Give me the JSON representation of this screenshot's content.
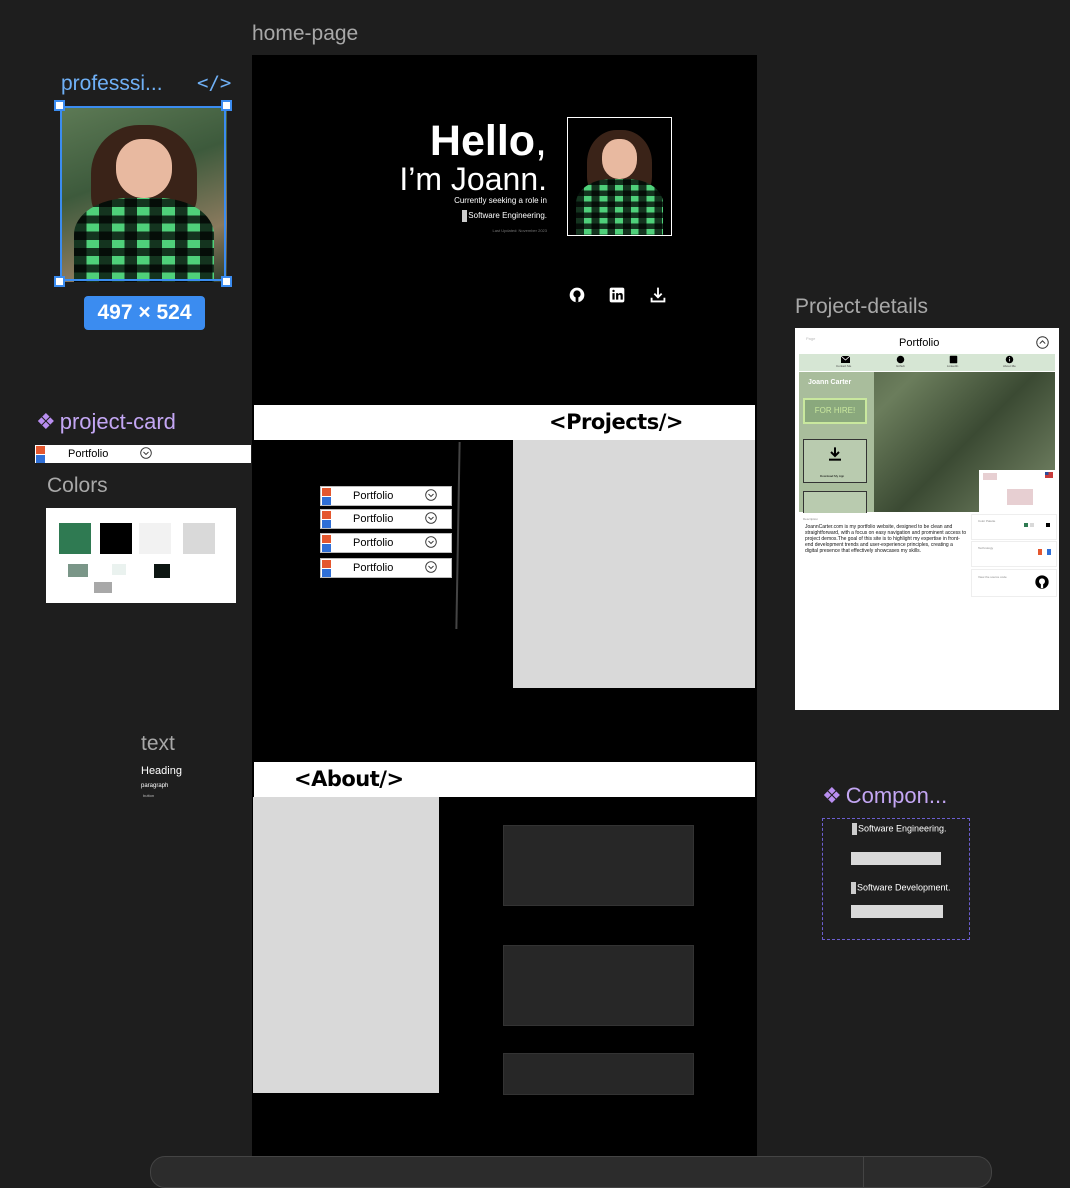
{
  "canvas": {
    "home_label": "home-page",
    "details_label": "Project-details",
    "card_label": "project-card",
    "colors_label": "Colors",
    "text_label": "text",
    "component_label": "Compon..."
  },
  "selection": {
    "label": "professsi...",
    "size": "497 × 524"
  },
  "hero": {
    "hello": "Hello",
    "comma": ",",
    "name": "I’m Joann.",
    "seeking": "Currently seeking a role in",
    "role": "Software Engineering.",
    "last_updated": "Last Updated: November 2023"
  },
  "sections": {
    "projects": "<Projects/>",
    "about": "<About/>"
  },
  "project_card": {
    "label": "Portfolio"
  },
  "project_list": [
    "Portfolio",
    "Portfolio",
    "Portfolio",
    "Portfolio"
  ],
  "colors": {
    "swatches": [
      "#2f7a52",
      "#000000",
      "#f2f2f2",
      "#d9d9d9",
      "#7a9688",
      "#eaf2ef",
      "#0d1612",
      "#a8a8a8"
    ]
  },
  "text_styles": {
    "heading": "Heading",
    "paragraph": "paragraph",
    "small": "button"
  },
  "details": {
    "title": "Portfolio",
    "nav": [
      "Contact Me",
      "Github",
      "LinkedIn",
      "About Me"
    ],
    "brand": "Joann Carter",
    "for_hire": "FOR HIRE!",
    "download": "Download My App",
    "description_label": "Description",
    "description": "JoannCarter.com is my portfolio website, designed to be clean and straightforward, with a focus on easy navigation and prominent access to project demos.The goal of this site is to highlight my expertise in front-end development trends and user-experience principles, creating a digital presence that effectively showcases my skills.",
    "color_palette_label": "Color Palette",
    "technology_label": "Technology",
    "view_source": "View the source code",
    "top_left": "Page"
  },
  "component": {
    "line1": "Software Engineering.",
    "line2": "Software Development."
  }
}
